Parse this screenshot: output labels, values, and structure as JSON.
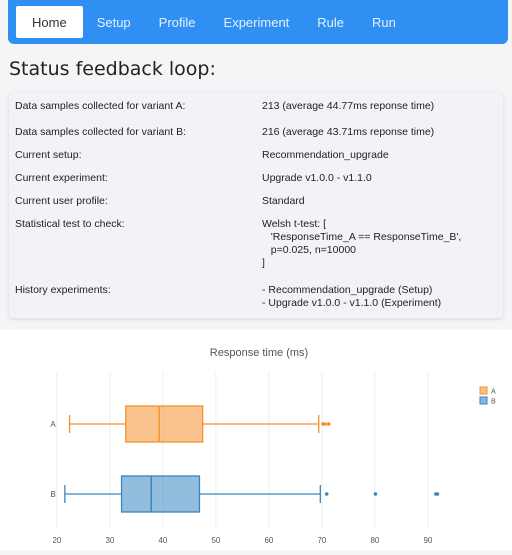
{
  "nav": {
    "items": [
      {
        "label": "Home",
        "active": true
      },
      {
        "label": "Setup",
        "active": false
      },
      {
        "label": "Profile",
        "active": false
      },
      {
        "label": "Experiment",
        "active": false
      },
      {
        "label": "Rule",
        "active": false
      },
      {
        "label": "Run",
        "active": false
      }
    ]
  },
  "page_title": "Status feedback loop:",
  "status": {
    "rows": [
      {
        "label": "Data samples collected for variant A:",
        "value": [
          "213 (average 44.77ms reponse time)"
        ]
      },
      {
        "label": "Data samples collected for variant B:",
        "value": [
          "216 (average 43.71ms reponse time)"
        ]
      },
      {
        "label": "Current setup:",
        "value": [
          "Recommendation_upgrade"
        ]
      },
      {
        "label": "Current experiment:",
        "value": [
          "Upgrade v1.0.0 - v1.1.0"
        ]
      },
      {
        "label": "Current user profile:",
        "value": [
          "Standard"
        ]
      },
      {
        "label": "Statistical test to check:",
        "value": [
          "Welsh t-test: [",
          "   'ResponseTime_A == ResponseTime_B',",
          "   p=0.025, n=10000",
          "]"
        ]
      },
      {
        "label": "History experiments:",
        "value": [
          "- Recommendation_upgrade (Setup)",
          "- Upgrade v1.0.0 - v1.1.0 (Experiment)"
        ]
      }
    ]
  },
  "colors": {
    "nav_bg": "#2f8ff2",
    "series_a": "#f5922f",
    "series_b": "#3a86bf"
  },
  "chart_data": {
    "type": "box",
    "title": "Response time (ms)",
    "xlabel": "",
    "ylabel": "",
    "xlim": [
      17,
      97
    ],
    "x_ticks": [
      20,
      30,
      40,
      50,
      60,
      70,
      80,
      90
    ],
    "categories": [
      "A",
      "B"
    ],
    "legend": {
      "position": "top-right",
      "entries": [
        "A",
        "B"
      ]
    },
    "series": [
      {
        "name": "A",
        "min": 22.4,
        "q1": 33.0,
        "median": 39.3,
        "q3": 47.5,
        "max": 69.4,
        "outliers": [
          70.2,
          70.6,
          71.3
        ]
      },
      {
        "name": "B",
        "min": 21.5,
        "q1": 32.2,
        "median": 37.8,
        "q3": 46.9,
        "max": 69.7,
        "outliers": [
          70.9,
          80.1,
          91.5,
          91.8
        ]
      }
    ],
    "grid": true
  }
}
